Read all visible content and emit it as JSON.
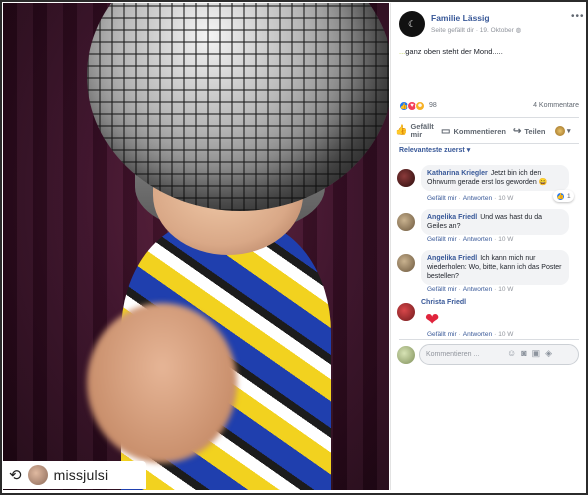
{
  "regram": {
    "icon": "repost-icon",
    "username": "missjulsi"
  },
  "post": {
    "page_name": "Familie Lässig",
    "meta_liked_by": "Seite gefällt dir",
    "meta_sep": "·",
    "meta_date": "19. Oktober",
    "meta_icon": "globe-icon",
    "text_dots": "...",
    "text": "ganz oben steht der Mond.....",
    "reaction_count": "98",
    "comment_count": "4 Kommentare",
    "reactions": [
      "like-icon",
      "love-icon",
      "haha-icon"
    ]
  },
  "actions": {
    "like_label": "Gefällt mir",
    "comment_label": "Kommentieren",
    "share_label": "Teilen"
  },
  "sort_label": "Relevanteste zuerst ▾",
  "comments": [
    {
      "author": "Katharina Kriegler",
      "text": "Jetzt bin ich den Ohrwurm gerade erst los geworden 😄",
      "like": "Gefällt mir",
      "reply": "Antworten",
      "time": "10 W",
      "likes": "1"
    },
    {
      "author": "Angelika Friedl",
      "text": "Und was hast du da Geiles an?",
      "like": "Gefällt mir",
      "reply": "Antworten",
      "time": "10 W"
    },
    {
      "author": "Angelika Friedl",
      "text": "Ich kann mich nur wiederholen: Wo, bitte, kann ich das Poster bestellen?",
      "like": "Gefällt mir",
      "reply": "Antworten",
      "time": "10 W"
    },
    {
      "author": "Christa Friedl",
      "text": "❤",
      "like": "Gefällt mir",
      "reply": "Antworten",
      "time": "10 W"
    }
  ],
  "composer": {
    "placeholder": "Kommentieren ...",
    "icons": [
      "emoji-icon",
      "camera-icon",
      "gif-icon",
      "sticker-icon"
    ]
  }
}
